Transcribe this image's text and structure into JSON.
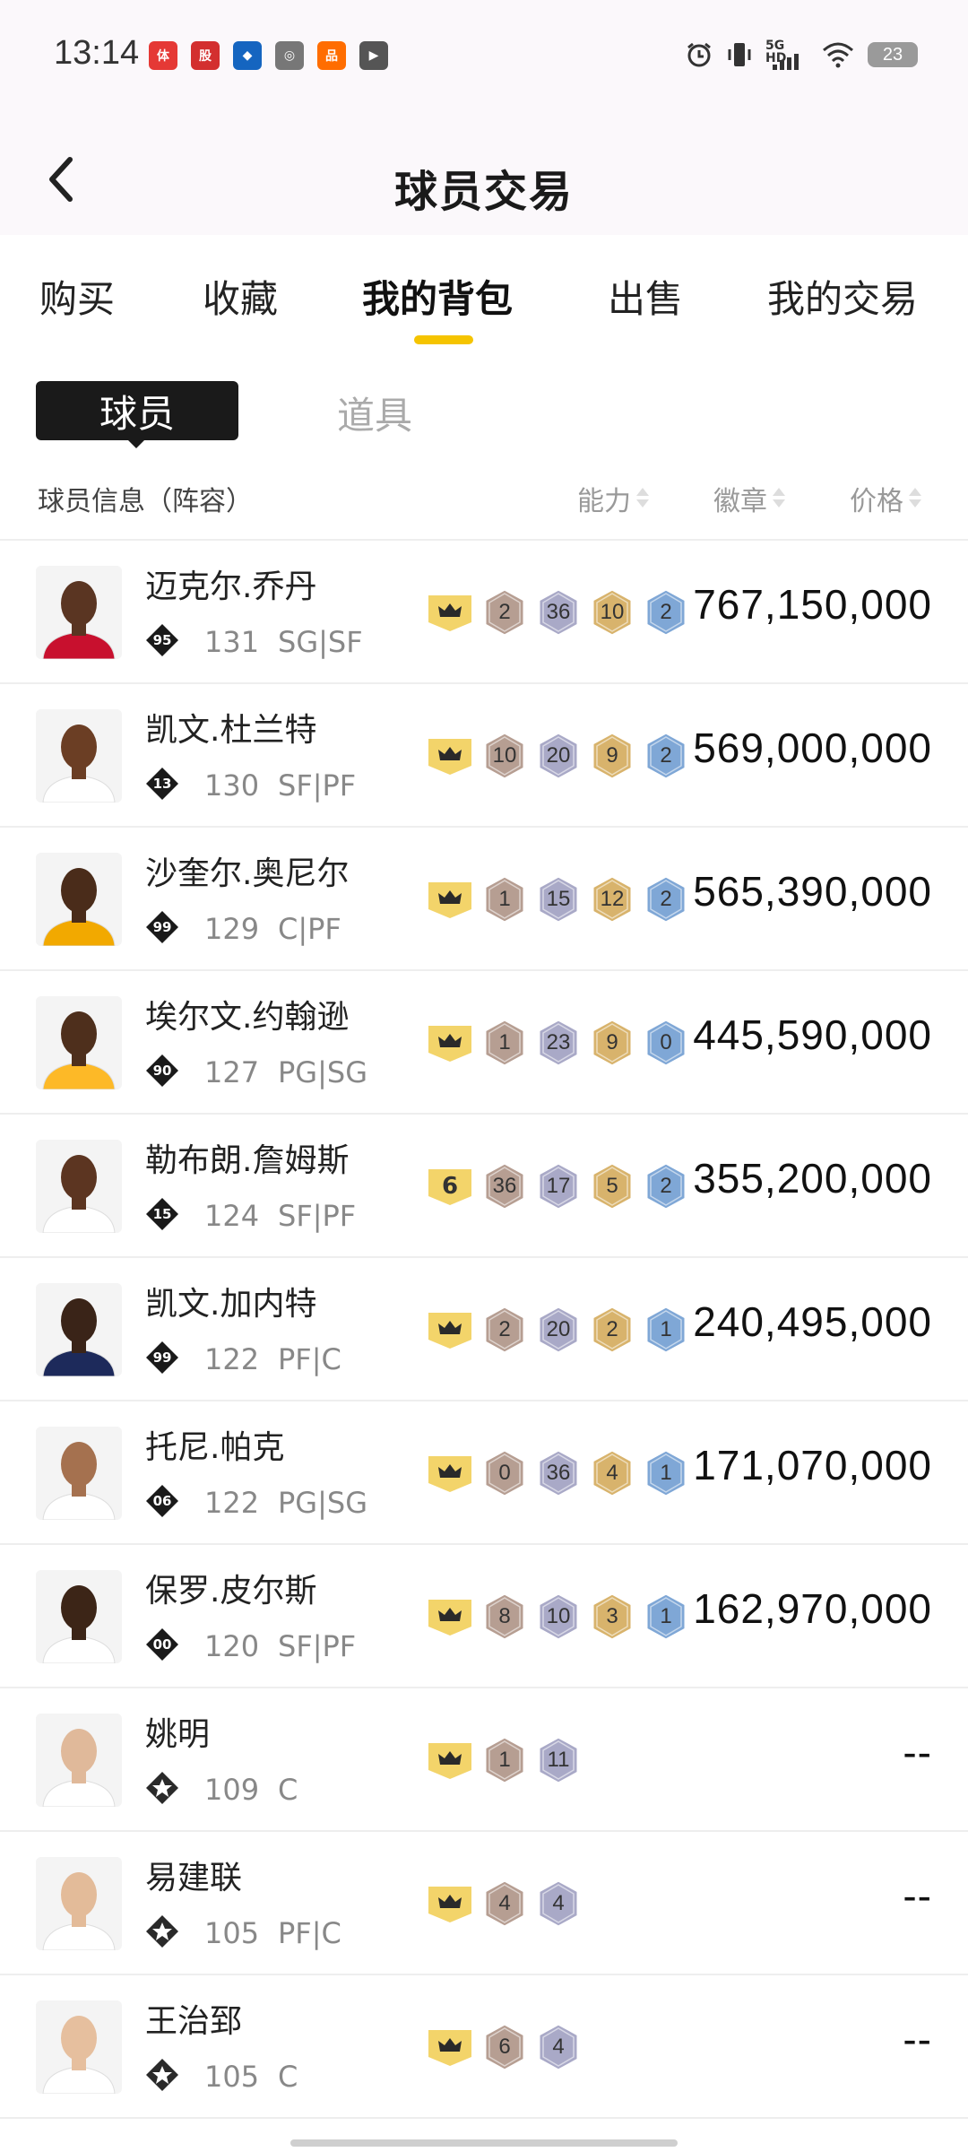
{
  "status": {
    "time": "13:14",
    "network": "5G HD",
    "battery": "23",
    "apps": [
      {
        "name": "app-1",
        "color": "#e53935",
        "glyph": "体"
      },
      {
        "name": "app-2",
        "color": "#d32f2f",
        "glyph": "股"
      },
      {
        "name": "app-3",
        "color": "#1565c0",
        "glyph": "◆"
      },
      {
        "name": "app-4",
        "color": "#777777",
        "glyph": "◎"
      },
      {
        "name": "app-5",
        "color": "#ff6d00",
        "glyph": "品"
      },
      {
        "name": "app-6",
        "color": "#555555",
        "glyph": "▶"
      }
    ]
  },
  "nav": {
    "title": "球员交易"
  },
  "tabs": [
    "购买",
    "收藏",
    "我的背包",
    "出售",
    "我的交易"
  ],
  "active_tab": 2,
  "segments": {
    "active": "球员",
    "inactive": "道具"
  },
  "columns": {
    "info": "球员信息（阵容）",
    "ability": "能力",
    "badges": "徽章",
    "price": "价格"
  },
  "colors": {
    "accent": "#f5c400",
    "crown": "#f3d46a",
    "bronze": "#b69e92",
    "silver": "#a9a9c7",
    "gold": "#d8b36c",
    "blue": "#7fa7d6"
  },
  "players": [
    {
      "name": "迈克尔.乔丹",
      "rank": "95",
      "overall": "131",
      "pos": "SG|SF",
      "crown": "",
      "badges": [
        "2",
        "36",
        "10",
        "2"
      ],
      "price": "767,150,000",
      "skin": "#5a3522",
      "jersey": "#c8102e"
    },
    {
      "name": "凯文.杜兰特",
      "rank": "13",
      "overall": "130",
      "pos": "SF|PF",
      "crown": "",
      "badges": [
        "10",
        "20",
        "9",
        "2"
      ],
      "price": "569,000,000",
      "skin": "#6b3e24",
      "jersey": "#ffffff"
    },
    {
      "name": "沙奎尔.奥尼尔",
      "rank": "99",
      "overall": "129",
      "pos": "C|PF",
      "crown": "",
      "badges": [
        "1",
        "15",
        "12",
        "2"
      ],
      "price": "565,390,000",
      "skin": "#4a2c1a",
      "jersey": "#f2a900"
    },
    {
      "name": "埃尔文.约翰逊",
      "rank": "90",
      "overall": "127",
      "pos": "PG|SG",
      "crown": "",
      "badges": [
        "1",
        "23",
        "9",
        "0"
      ],
      "price": "445,590,000",
      "skin": "#4e2f1c",
      "jersey": "#fdb927"
    },
    {
      "name": "勒布朗.詹姆斯",
      "rank": "15",
      "overall": "124",
      "pos": "SF|PF",
      "crown": "6",
      "badges": [
        "36",
        "17",
        "5",
        "2"
      ],
      "price": "355,200,000",
      "skin": "#5c3521",
      "jersey": "#ffffff"
    },
    {
      "name": "凯文.加内特",
      "rank": "99",
      "overall": "122",
      "pos": "PF|C",
      "crown": "",
      "badges": [
        "2",
        "20",
        "2",
        "1"
      ],
      "price": "240,495,000",
      "skin": "#3a2418",
      "jersey": "#1d2a5b"
    },
    {
      "name": "托尼.帕克",
      "rank": "06",
      "overall": "122",
      "pos": "PG|SG",
      "crown": "",
      "badges": [
        "0",
        "36",
        "4",
        "1"
      ],
      "price": "171,070,000",
      "skin": "#a5714f",
      "jersey": "#ffffff"
    },
    {
      "name": "保罗.皮尔斯",
      "rank": "00",
      "overall": "120",
      "pos": "SF|PF",
      "crown": "",
      "badges": [
        "8",
        "10",
        "3",
        "1"
      ],
      "price": "162,970,000",
      "skin": "#3c2517",
      "jersey": "#ffffff"
    },
    {
      "name": "姚明",
      "rank": "",
      "overall": "109",
      "pos": "C",
      "crown": "",
      "badges": [
        "1",
        "11"
      ],
      "price": "--",
      "skin": "#e0b99a",
      "jersey": "#ffffff"
    },
    {
      "name": "易建联",
      "rank": "",
      "overall": "105",
      "pos": "PF|C",
      "crown": "",
      "badges": [
        "4",
        "4"
      ],
      "price": "--",
      "skin": "#e3bb99",
      "jersey": "#ffffff"
    },
    {
      "name": "王治郅",
      "rank": "",
      "overall": "105",
      "pos": "C",
      "crown": "",
      "badges": [
        "6",
        "4"
      ],
      "price": "--",
      "skin": "#e6bf9e",
      "jersey": "#ffffff"
    }
  ]
}
